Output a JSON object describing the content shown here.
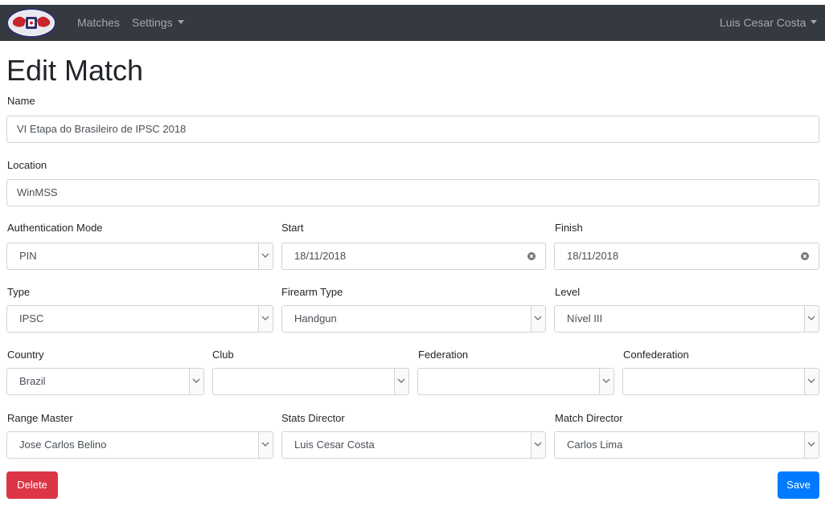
{
  "nav": {
    "links": [
      "Matches",
      "Settings"
    ],
    "user": "Luis Cesar Costa"
  },
  "page": {
    "title": "Edit Match"
  },
  "form": {
    "name": {
      "label": "Name",
      "value": "VI Etapa do Brasileiro de IPSC 2018"
    },
    "location": {
      "label": "Location",
      "value": "WinMSS"
    },
    "auth_mode": {
      "label": "Authentication Mode",
      "value": "PIN"
    },
    "start": {
      "label": "Start",
      "value": "18/11/2018"
    },
    "finish": {
      "label": "Finish",
      "value": "18/11/2018"
    },
    "type": {
      "label": "Type",
      "value": "IPSC"
    },
    "firearm_type": {
      "label": "Firearm Type",
      "value": "Handgun"
    },
    "level": {
      "label": "Level",
      "value": "Nível III"
    },
    "country": {
      "label": "Country",
      "value": "Brazil"
    },
    "club": {
      "label": "Club",
      "value": ""
    },
    "federation": {
      "label": "Federation",
      "value": ""
    },
    "confederation": {
      "label": "Confederation",
      "value": ""
    },
    "range_master": {
      "label": "Range Master",
      "value": "Jose Carlos Belino"
    },
    "stats_director": {
      "label": "Stats Director",
      "value": "Luis Cesar Costa"
    },
    "match_director": {
      "label": "Match Director",
      "value": "Carlos Lima"
    }
  },
  "buttons": {
    "delete": "Delete",
    "save": "Save"
  },
  "colors": {
    "navbar": "#343a40",
    "danger": "#dc3545",
    "primary": "#007bff",
    "border": "#ced4da"
  }
}
